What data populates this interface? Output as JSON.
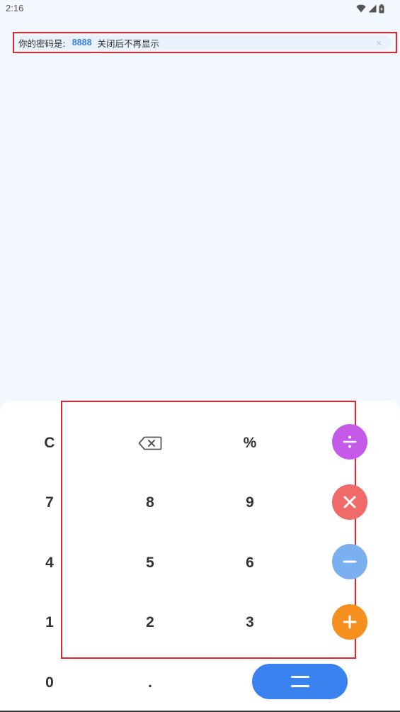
{
  "status_bar": {
    "time": "2:16"
  },
  "notice": {
    "prefix": "你的密码是:",
    "password": "8888",
    "suffix": "关闭后不再显示",
    "close_glyph": "×"
  },
  "keypad": {
    "clear": "C",
    "percent": "%",
    "digits": {
      "seven": "7",
      "eight": "8",
      "nine": "9",
      "four": "4",
      "five": "5",
      "six": "6",
      "one": "1",
      "two": "2",
      "three": "3",
      "zero": "0",
      "dot": "."
    },
    "colors": {
      "divide": "#c65ae8",
      "multiply": "#f06a6a",
      "minus": "#7aaff0",
      "plus": "#f5901f",
      "equals": "#3a82f0"
    },
    "icons": {
      "backspace": "backspace-icon",
      "divide": "divide-icon",
      "multiply": "multiply-icon",
      "minus": "minus-icon",
      "plus": "plus-icon",
      "equals": "equals-icon"
    }
  }
}
